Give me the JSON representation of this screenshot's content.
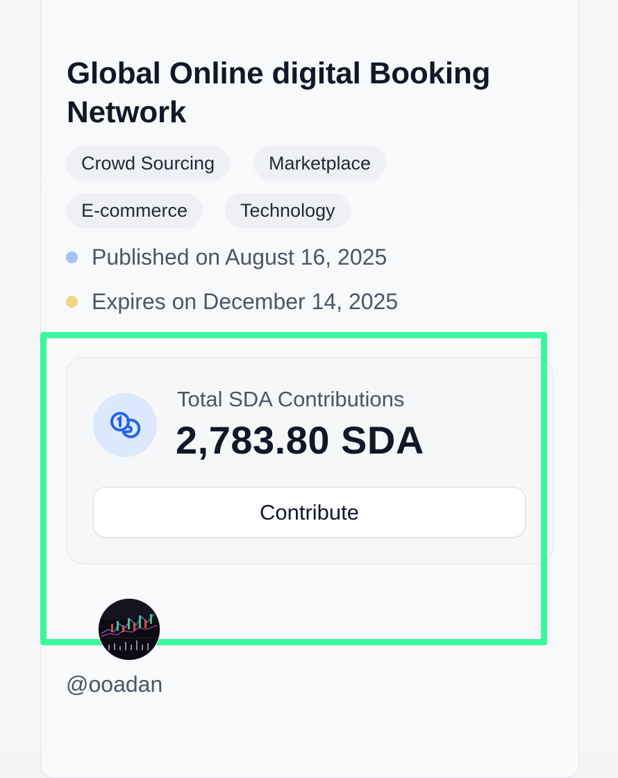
{
  "project": {
    "title": "Global Online digital Booking Network",
    "tags": [
      "Crowd Sourcing",
      "Marketplace",
      "E-commerce",
      "Technology"
    ],
    "published_text": "Published on August 16, 2025",
    "expires_text": "Expires on December 14, 2025"
  },
  "contributions": {
    "label": "Total SDA Contributions",
    "amount": "2,783.80 SDA",
    "icon": "coins-icon",
    "button_label": "Contribute"
  },
  "creator": {
    "username": "@ooadan",
    "avatar_icon": "trading-chart-avatar"
  },
  "colors": {
    "published_dot": "#a3c2f5",
    "expires_dot": "#f3d57e",
    "coin_icon": "#2563eb",
    "coin_circle_bg": "#dce8fb",
    "highlight": "#3df59a"
  }
}
